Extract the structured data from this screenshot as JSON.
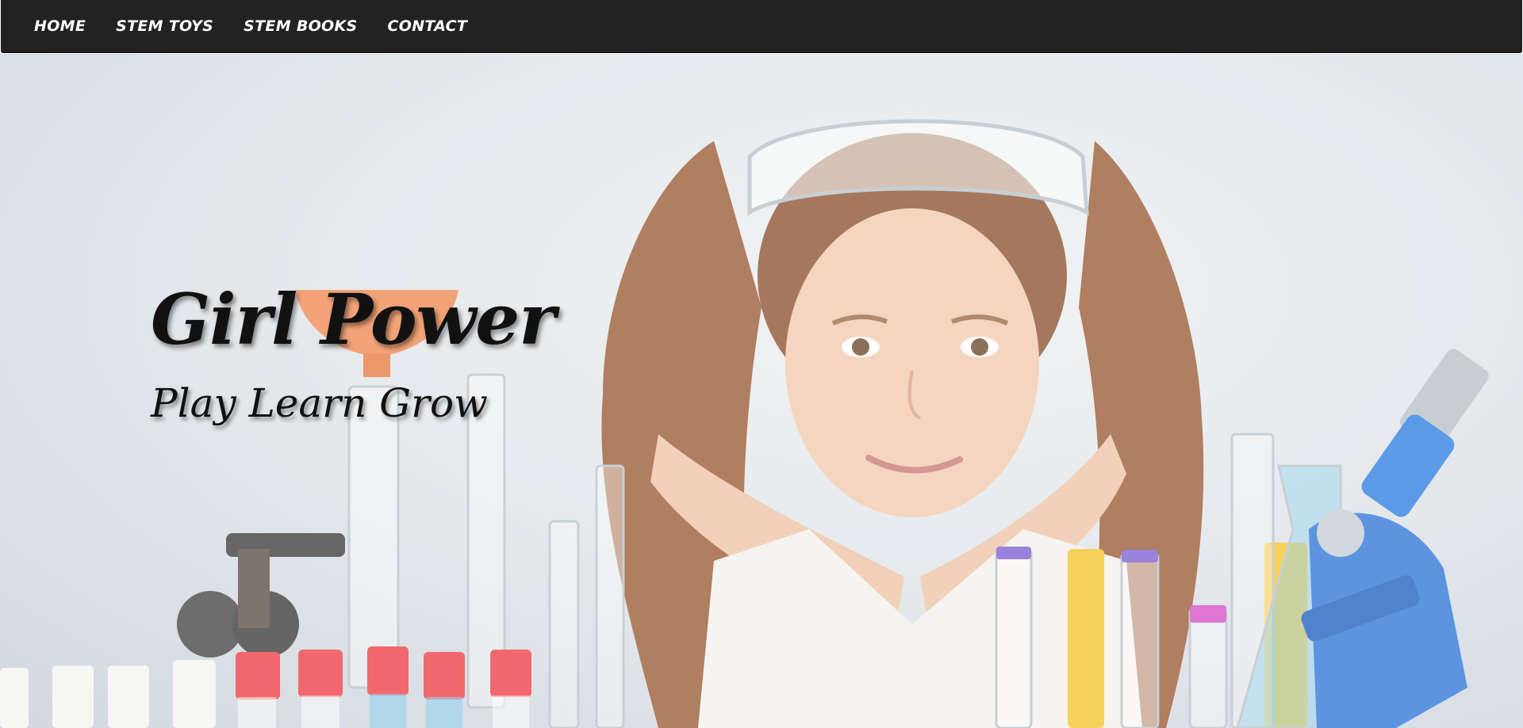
{
  "nav": {
    "items": [
      {
        "label": "HOME"
      },
      {
        "label": "STEM TOYS"
      },
      {
        "label": "STEM BOOKS"
      },
      {
        "label": "CONTACT"
      }
    ]
  },
  "hero": {
    "title": "Girl Power",
    "subtitle": "Play Learn Grow",
    "image_subject": "girl-scientist-with-lab-glassware-photo"
  },
  "colors": {
    "nav_background": "#222222",
    "nav_text": "#ffffff",
    "hero_text": "#111111"
  }
}
